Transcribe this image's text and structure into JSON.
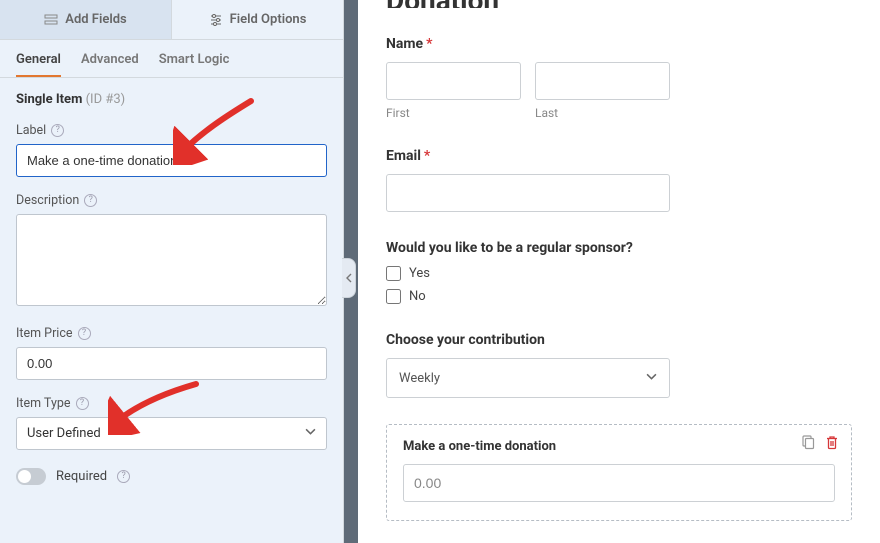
{
  "sidebar": {
    "top_tabs": {
      "add_fields": "Add Fields",
      "field_options": "Field Options"
    },
    "sub_tabs": {
      "general": "General",
      "advanced": "Advanced",
      "smart_logic": "Smart Logic"
    },
    "field_title": "Single Item",
    "field_id": "(ID #3)",
    "label": {
      "title": "Label",
      "value": "Make a one-time donation"
    },
    "description": {
      "title": "Description",
      "value": ""
    },
    "item_price": {
      "title": "Item Price",
      "value": "0.00"
    },
    "item_type": {
      "title": "Item Type",
      "value": "User Defined"
    },
    "required": {
      "title": "Required"
    }
  },
  "preview": {
    "page_title": "Donation",
    "name": {
      "label": "Name",
      "first": "First",
      "last": "Last"
    },
    "email": {
      "label": "Email"
    },
    "sponsor": {
      "label": "Would you like to be a regular sponsor?",
      "yes": "Yes",
      "no": "No"
    },
    "contribution": {
      "label": "Choose your contribution",
      "value": "Weekly"
    },
    "single_item": {
      "label": "Make a one-time donation",
      "value": "0.00"
    }
  }
}
